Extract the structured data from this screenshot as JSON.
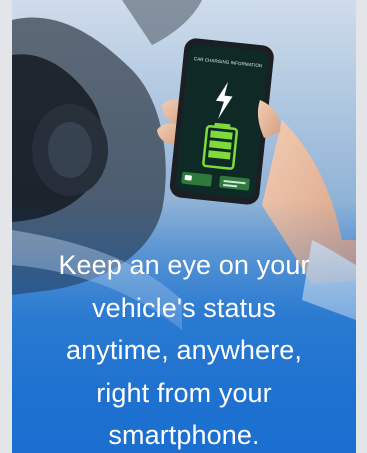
{
  "hero": {
    "caption_lines": [
      "Keep an eye on your",
      "vehicle's status",
      "anytime, anywhere,",
      "right from your",
      "smartphone."
    ]
  },
  "phone": {
    "screen_title": "CAR CHARGING INFORMATION",
    "icons": [
      "lightning-bolt-icon",
      "battery-icon",
      "car-icon"
    ],
    "battery_level": 1.0
  },
  "colors": {
    "accent": "#1a6fd0",
    "phone_screen": "#0f2a26",
    "battery_green": "#7fdb3a",
    "caption_text": "#ffffff"
  }
}
